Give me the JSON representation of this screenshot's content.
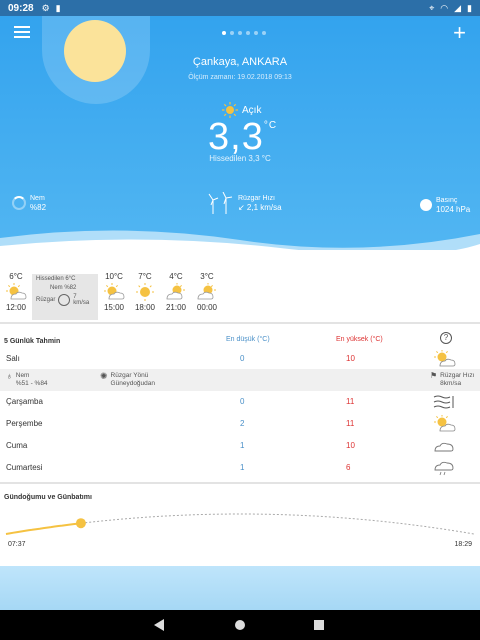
{
  "status_bar": {
    "time": "09:28"
  },
  "header": {
    "location": "Çankaya, ANKARA",
    "updated": "Ölçüm zamanı: 19.02.2018 09:13",
    "condition": "Açık",
    "temperature": "3,3",
    "temp_unit": "°C",
    "feels_like": "Hissedilen 3,3 °C",
    "humidity_label": "Nem",
    "humidity_value": "%82",
    "wind_label": "Rüzgar Hızı",
    "wind_value": "↙ 2,1 km/sa",
    "pressure_label": "Basınç",
    "pressure_value": "1024 hPa",
    "page_dots": 6,
    "active_dot": 0
  },
  "hourly": {
    "hours": [
      {
        "temp": "6°C",
        "time": "12:00",
        "icon": "partly-sunny-icon"
      },
      {
        "temp": "10°C",
        "time": "15:00",
        "icon": "partly-sunny-icon"
      },
      {
        "temp": "7°C",
        "time": "18:00",
        "icon": "sunny-icon"
      },
      {
        "temp": "4°C",
        "time": "21:00",
        "icon": "partly-sunny-icon"
      },
      {
        "temp": "3°C",
        "time": "00:00",
        "icon": "partly-sunny-icon"
      }
    ],
    "detail": {
      "feels": "Hissedilen 6°C",
      "humidity": "Nem %82",
      "wind_label": "Rüzgar",
      "wind_value": "7 km/sa"
    }
  },
  "forecast": {
    "title": "5 Günlük Tahmin",
    "min_header": "En düşük (°C)",
    "max_header": "En yüksek (°C)",
    "help": "?",
    "days": [
      {
        "name": "Salı",
        "min": "0",
        "max": "10",
        "icon": "partly-sunny-icon"
      },
      {
        "name": "Çarşamba",
        "min": "0",
        "max": "11",
        "icon": "wind-icon"
      },
      {
        "name": "Perşembe",
        "min": "2",
        "max": "11",
        "icon": "partly-sunny-icon"
      },
      {
        "name": "Cuma",
        "min": "1",
        "max": "10",
        "icon": "cloud-icon"
      },
      {
        "name": "Cumartesi",
        "min": "1",
        "max": "6",
        "icon": "rain-cloud-icon"
      }
    ],
    "detail": {
      "humidity_label": "Nem",
      "humidity_value": "%51 - %84",
      "wind_dir_label": "Rüzgar Yönü",
      "wind_dir_value": "Güneydoğudan",
      "wind_speed_label": "Rüzgar Hızı",
      "wind_speed_value": "8km/sa"
    }
  },
  "sun": {
    "title": "Gündoğumu ve Günbatımı",
    "sunrise": "07:37",
    "sunset": "18:29",
    "progress": 0.16
  },
  "colors": {
    "sky": "#33a3ee",
    "min": "#4a90c8",
    "max": "#dd3333",
    "sun": "#f5c242"
  }
}
